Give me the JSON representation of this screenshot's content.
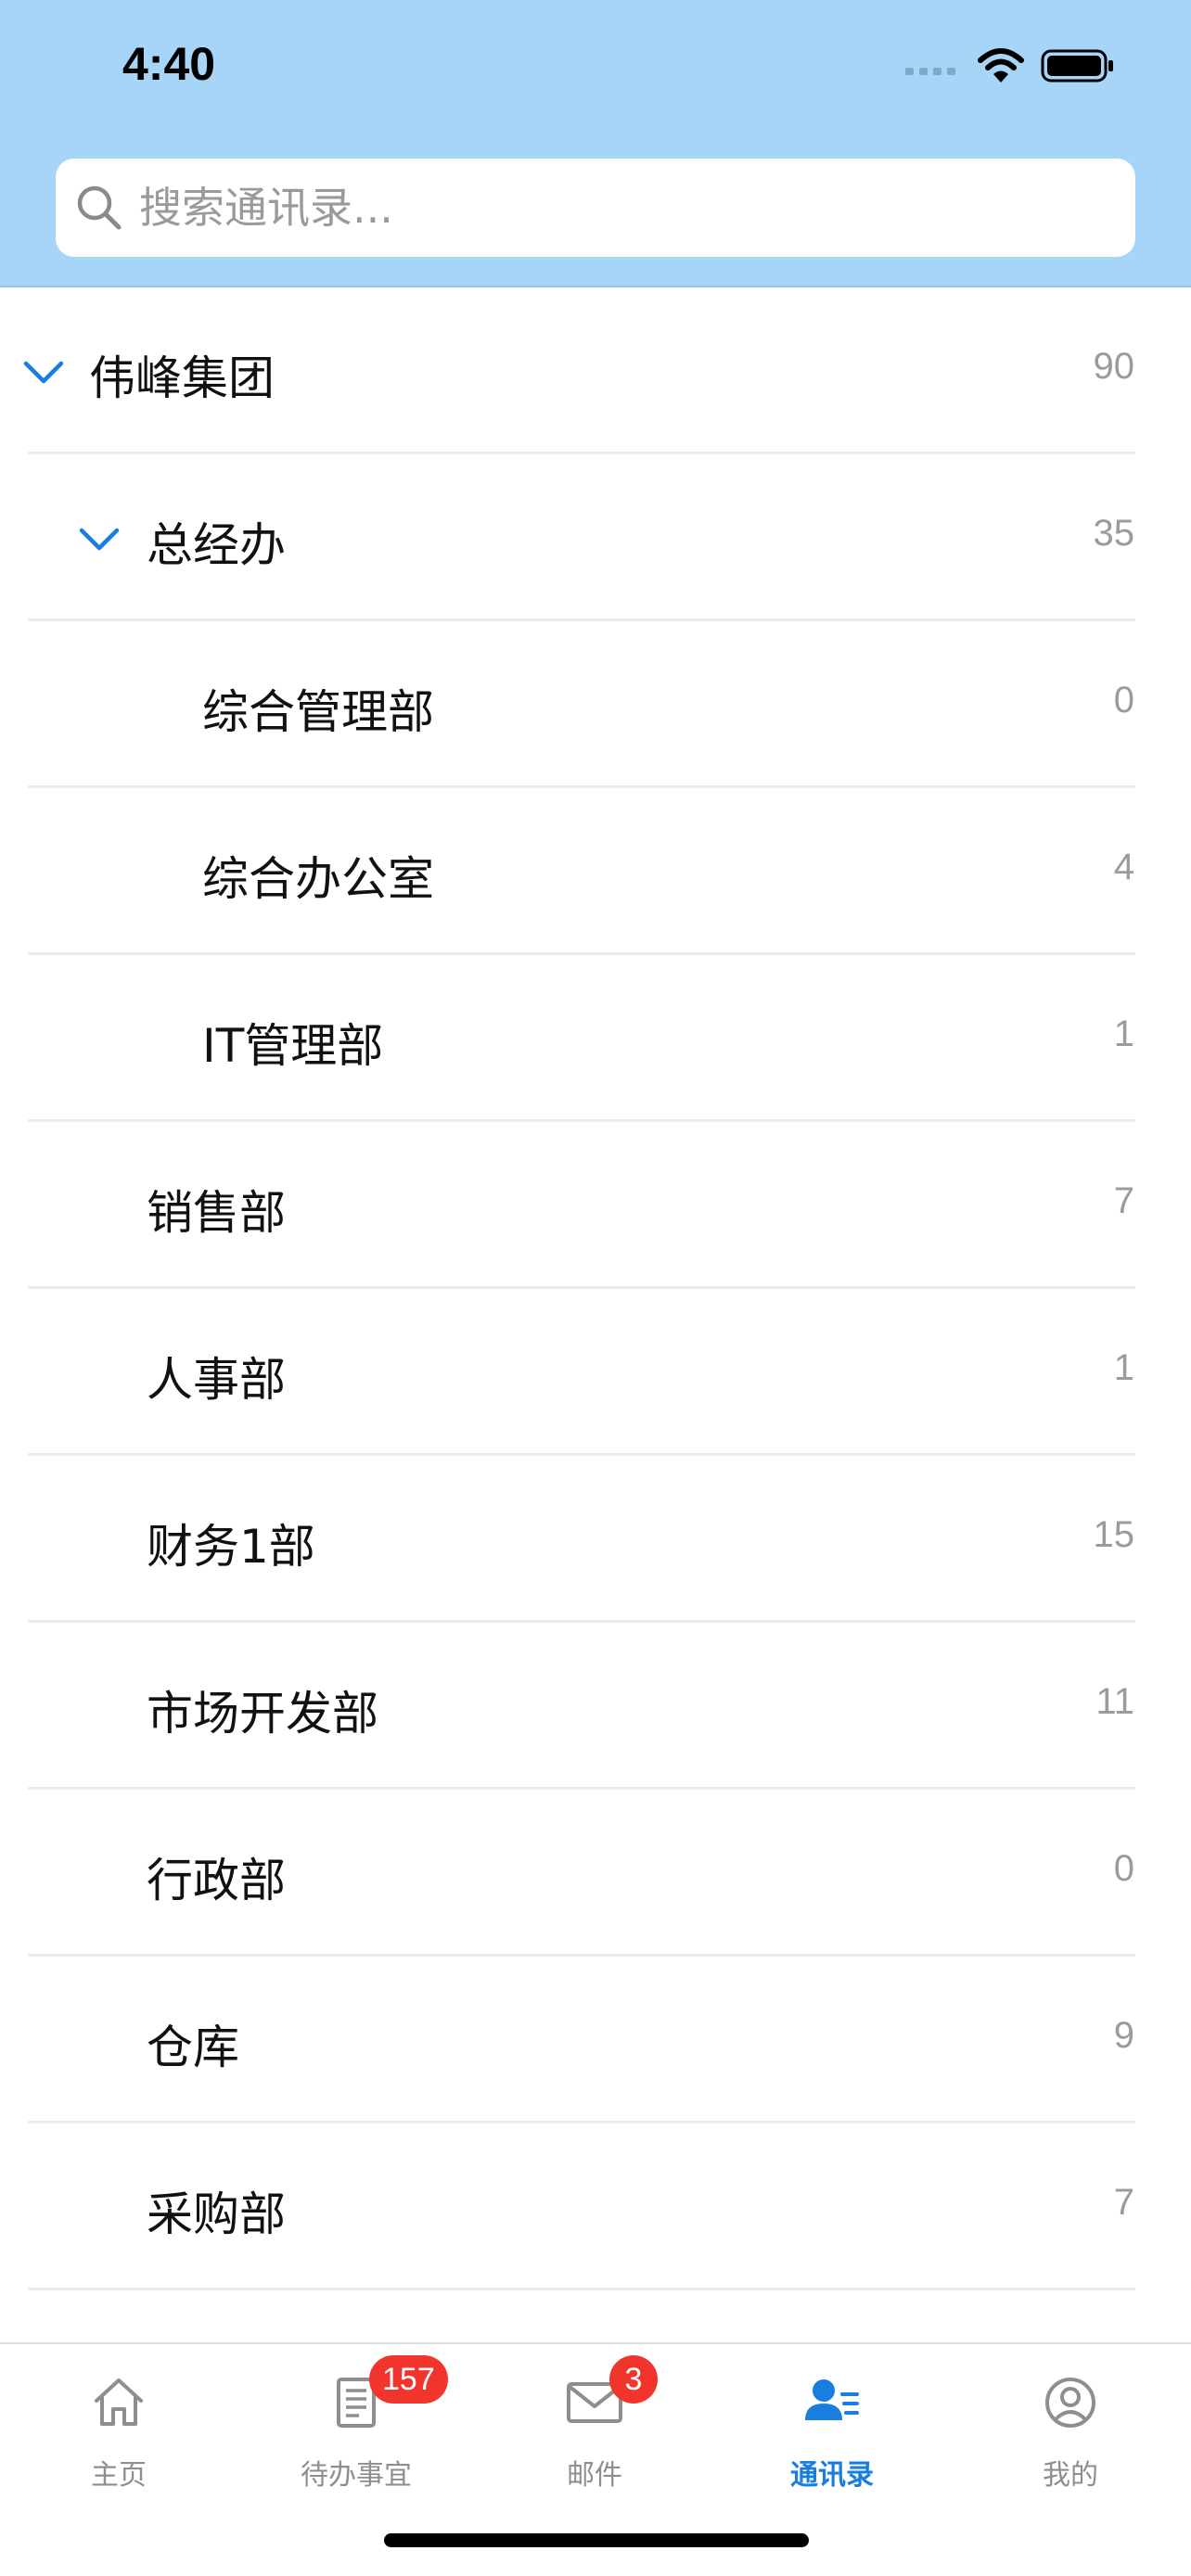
{
  "status_bar": {
    "time": "4:40"
  },
  "search": {
    "placeholder": "搜索通讯录..."
  },
  "tree": [
    {
      "name": "伟峰集团",
      "count": "90",
      "level": 0,
      "expanded": true
    },
    {
      "name": "总经办",
      "count": "35",
      "level": 1,
      "expanded": true
    },
    {
      "name": "综合管理部",
      "count": "0",
      "level": 2
    },
    {
      "name": "综合办公室",
      "count": "4",
      "level": 2
    },
    {
      "name": "IT管理部",
      "count": "1",
      "level": 2
    },
    {
      "name": "销售部",
      "count": "7",
      "level": 1
    },
    {
      "name": "人事部",
      "count": "1",
      "level": 1
    },
    {
      "name": "财务1部",
      "count": "15",
      "level": 1
    },
    {
      "name": "市场开发部",
      "count": "11",
      "level": 1
    },
    {
      "name": "行政部",
      "count": "0",
      "level": 1
    },
    {
      "name": "仓库",
      "count": "9",
      "level": 1
    },
    {
      "name": "采购部",
      "count": "7",
      "level": 1
    }
  ],
  "tabbar": {
    "tabs": [
      {
        "label": "主页",
        "icon": "home-icon"
      },
      {
        "label": "待办事宜",
        "icon": "todo-list-icon",
        "badge": "157"
      },
      {
        "label": "邮件",
        "icon": "mail-icon",
        "badge": "3"
      },
      {
        "label": "通讯录",
        "icon": "contacts-icon",
        "active": true
      },
      {
        "label": "我的",
        "icon": "profile-icon"
      }
    ]
  },
  "colors": {
    "header_bg": "#a6d5f8",
    "accent": "#1a7ee0",
    "badge": "#f1352c"
  }
}
